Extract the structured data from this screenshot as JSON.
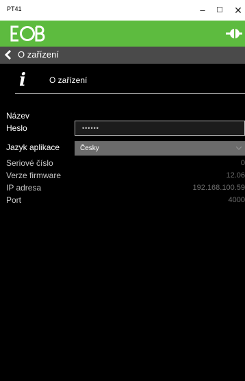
{
  "window": {
    "title": "PT41",
    "minimize_glyph": "–",
    "maximize_glyph": "☐",
    "close_glyph": "✕"
  },
  "header": {
    "logo_text": "EOB",
    "brand_color": "#5dbb3f"
  },
  "nav": {
    "back_label": "O zařízení"
  },
  "section": {
    "icon": "info-icon",
    "title": "O zařízení"
  },
  "form": {
    "name_label": "Název",
    "password_label": "Heslo",
    "password_value": "••••••",
    "language_label": "Jazyk aplikace",
    "language_value": "Česky",
    "serial_label": "Seriové číslo",
    "serial_value": "0",
    "firmware_label": "Verze firmware",
    "firmware_value": "12.06",
    "ip_label": "IP adresa",
    "ip_value": "192.168.100.59",
    "port_label": "Port",
    "port_value": "4000"
  }
}
